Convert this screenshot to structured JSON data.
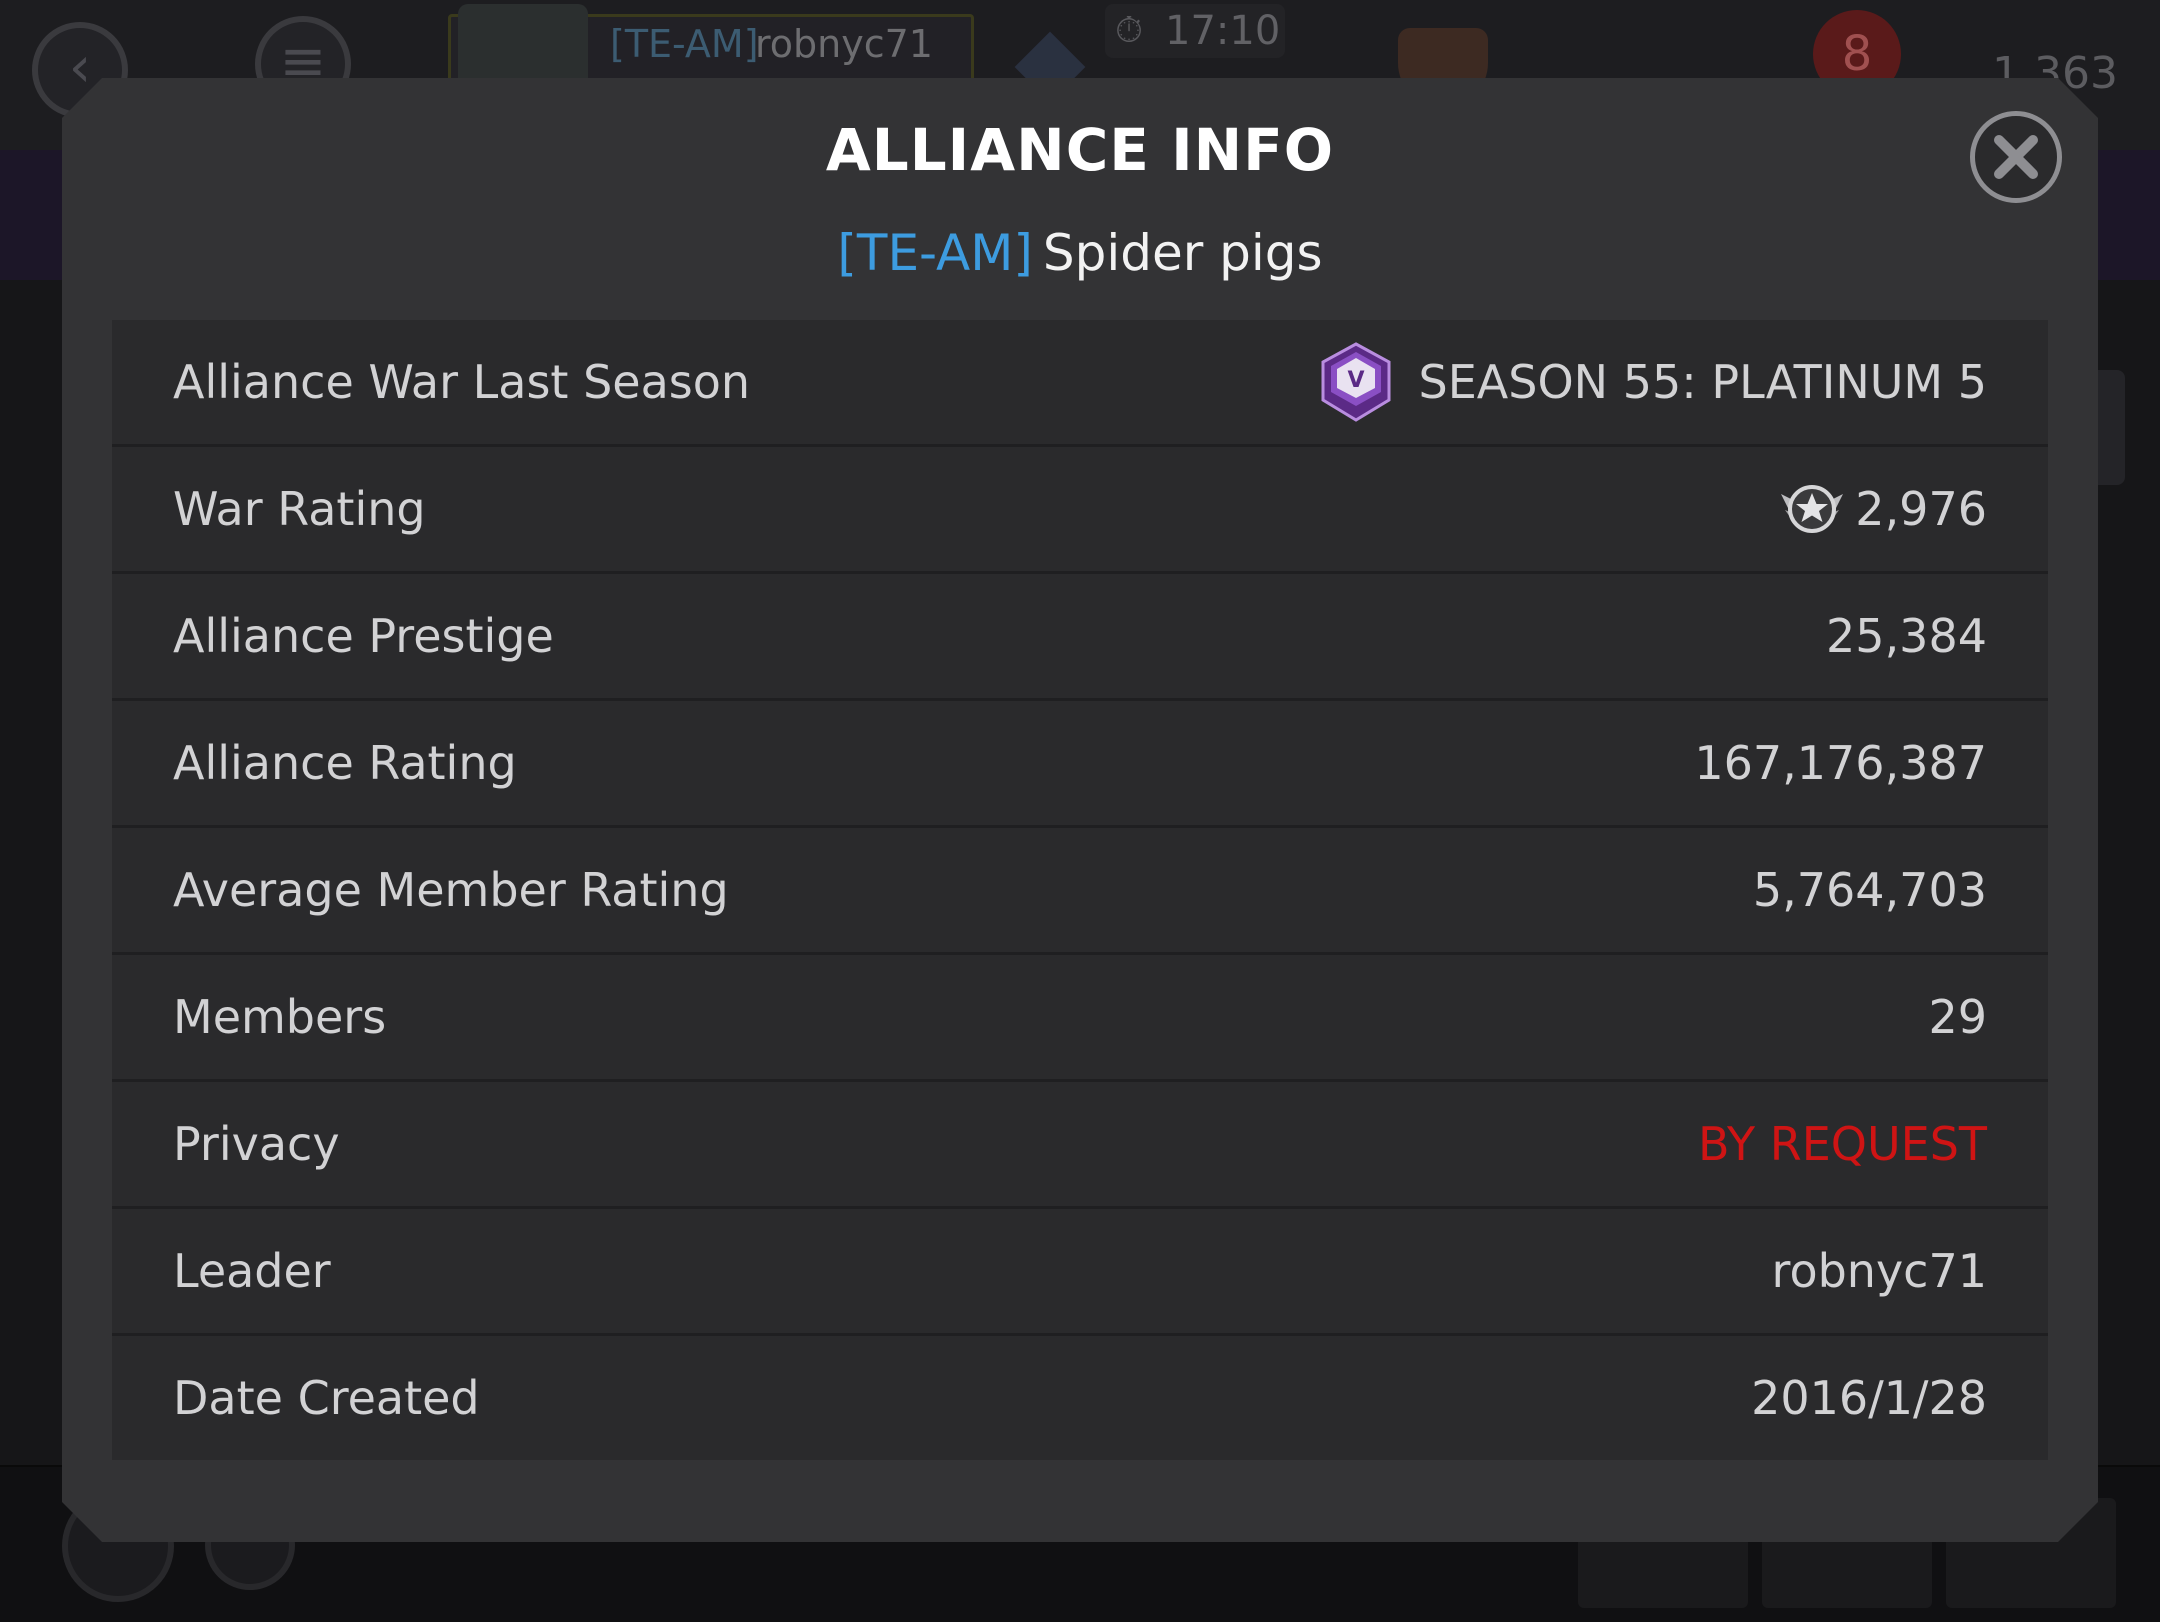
{
  "hud": {
    "player_tag": "[TE-AM]",
    "player_name": "robnyc71",
    "timer": "17:10",
    "notification_count": "8",
    "right_value": "1,363"
  },
  "dialog": {
    "title": "ALLIANCE INFO",
    "alliance_tag": "[TE-AM]",
    "alliance_name": "Spider pigs",
    "close_icon": "close-x-icon"
  },
  "rows": [
    {
      "label": "Alliance War Last Season",
      "value": "SEASON 55: PLATINUM 5",
      "icon": "season-badge-icon"
    },
    {
      "label": "War Rating",
      "value": "2,976",
      "icon": "war-rating-icon"
    },
    {
      "label": "Alliance Prestige",
      "value": "25,384"
    },
    {
      "label": "Alliance Rating",
      "value": "167,176,387"
    },
    {
      "label": "Average Member Rating",
      "value": "5,764,703"
    },
    {
      "label": "Members",
      "value": "29"
    },
    {
      "label": "Privacy",
      "value": "BY REQUEST",
      "color": "#cf1414"
    },
    {
      "label": "Leader",
      "value": "robnyc71"
    },
    {
      "label": "Date Created",
      "value": "2016/1/28"
    }
  ],
  "colors": {
    "tag_blue": "#3d9ce0",
    "privacy_red": "#cf1414",
    "badge_purple": "#7a3aa8"
  }
}
